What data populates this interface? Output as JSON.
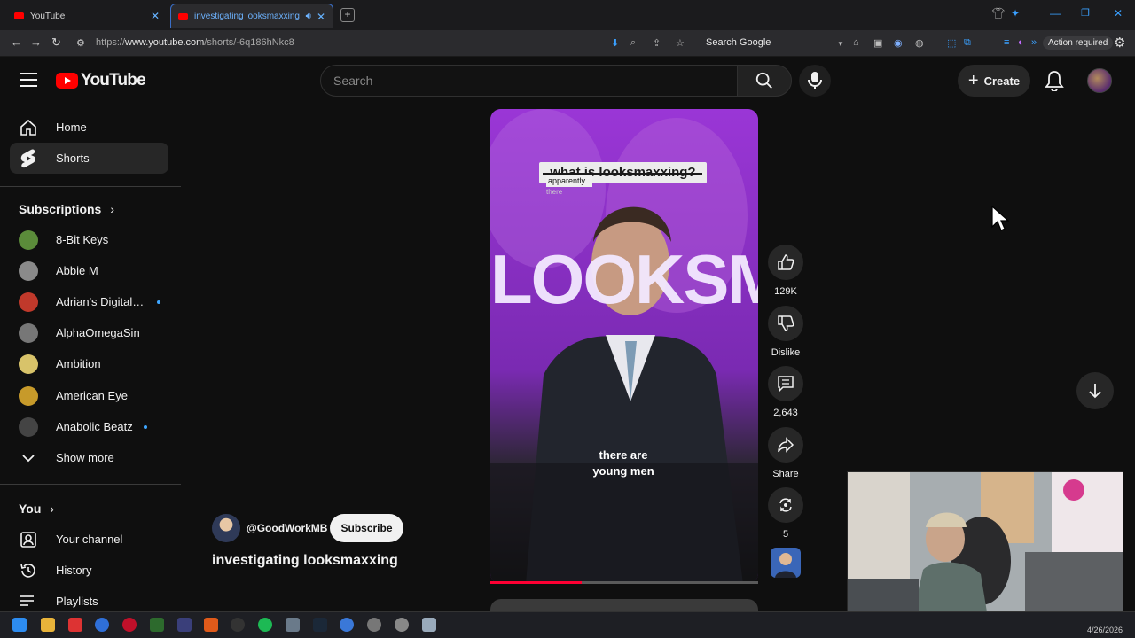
{
  "browser": {
    "tabs": [
      {
        "title": "YouTube",
        "active": false
      },
      {
        "title": "investigating looksmaxxing",
        "active": true
      }
    ],
    "url_prefix": "https://",
    "url_domain": "www.youtube.com",
    "url_path": "/shorts/-6q186hNkc8",
    "search_engine_label": "Search Google",
    "action_required_label": "Action required"
  },
  "header": {
    "logo_text": "YouTube",
    "search_placeholder": "Search",
    "create_label": "Create"
  },
  "sidebar": {
    "nav": [
      {
        "label": "Home",
        "icon": "home-icon"
      },
      {
        "label": "Shorts",
        "icon": "shorts-icon",
        "active": true
      }
    ],
    "subscriptions_heading": "Subscriptions",
    "subscriptions": [
      {
        "name": "8-Bit Keys",
        "new": false,
        "color": "#5b8c3a"
      },
      {
        "name": "Abbie M",
        "new": false,
        "color": "#8a8a8a"
      },
      {
        "name": "Adrian's Digital B...",
        "new": true,
        "color": "#c0392b"
      },
      {
        "name": "AlphaOmegaSin",
        "new": false,
        "color": "#777777"
      },
      {
        "name": "Ambition",
        "new": false,
        "color": "#d8c36a"
      },
      {
        "name": "American Eye",
        "new": false,
        "color": "#c79a2a"
      },
      {
        "name": "Anabolic Beatz",
        "new": true,
        "color": "#444444"
      }
    ],
    "show_more": "Show more",
    "you_heading": "You",
    "you_items": [
      {
        "label": "Your channel",
        "icon": "channel-icon"
      },
      {
        "label": "History",
        "icon": "history-icon"
      },
      {
        "label": "Playlists",
        "icon": "playlists-icon"
      }
    ]
  },
  "short": {
    "caption_top": "what is looksmaxxing?",
    "caption_small_1": "apparently",
    "caption_small_2": "there",
    "background_text": "LOOKSM",
    "subtitle_line1": "there are",
    "subtitle_line2": "young men",
    "progress_fraction": 0.34,
    "channel_handle": "@GoodWorkMB",
    "subscribe_label": "Subscribe",
    "title": "investigating looksmaxxing"
  },
  "actions": {
    "likes": "129K",
    "dislike_label": "Dislike",
    "comments": "2,643",
    "share_label": "Share",
    "remix_count": "5"
  },
  "taskbar": {
    "date": "4/26/2026"
  },
  "colors": {
    "brand_red": "#ff0000",
    "background": "#0f0f0f",
    "short_purple": "#7c2bb0",
    "accent_blue": "#3ea6ff"
  }
}
